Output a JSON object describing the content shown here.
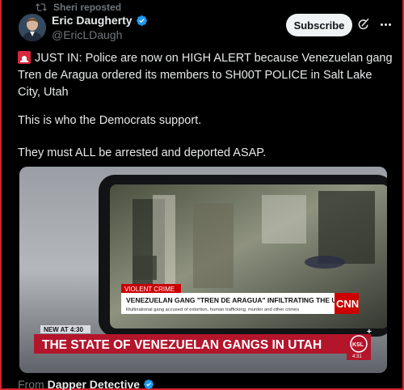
{
  "repost": {
    "label": "Sheri reposted"
  },
  "author": {
    "name": "Eric Daugherty",
    "handle": "@EricLDaugh"
  },
  "actions": {
    "subscribe_label": "Subscribe"
  },
  "post": {
    "paragraph1": "JUST IN: Police are now on HIGH ALERT because Venezuelan gang Tren de Aragua ordered its members to SH00T POLICE in Salt Lake City, Utah",
    "paragraph2": "This is who the Democrats support.",
    "paragraph3": "They must ALL be arrested and deported ASAP."
  },
  "media": {
    "cnn_tag": "VIOLENT CRIME",
    "cnn_headline": "VENEZUELAN GANG \"TREN DE ARAGUA\" INFILTRATING THE U.S.",
    "cnn_subline": "Multinational gang accused of extortion, human trafficking, murder and other crimes",
    "cnn_logo": "CNN",
    "ksl_time_label": "NEW AT 4:30",
    "ksl_headline": "THE STATE OF VENEZUELAN GANGS IN UTAH",
    "ksl_logo": "KSL",
    "ksl_clock": "4:31"
  },
  "footer": {
    "from_label": "From",
    "source_name": "Dapper Detective"
  },
  "colors": {
    "accent_red": "#c8102e",
    "verified_blue": "#1d9bf0",
    "cnn_red": "#cc0000"
  }
}
